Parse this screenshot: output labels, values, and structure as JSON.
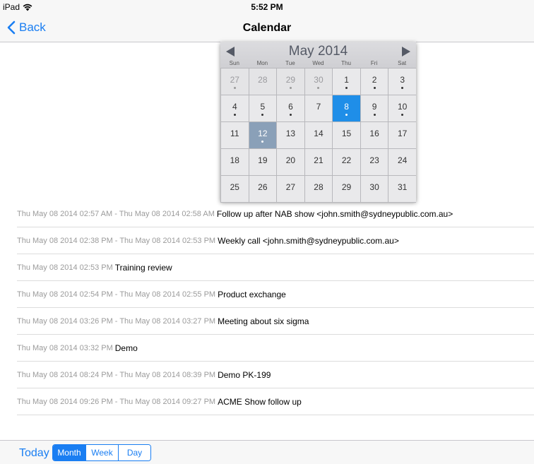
{
  "status_bar": {
    "device": "iPad",
    "time": "5:52 PM"
  },
  "nav": {
    "back_label": "Back",
    "title": "Calendar"
  },
  "calendar": {
    "month_title": "May 2014",
    "weekdays": [
      "Sun",
      "Mon",
      "Tue",
      "Wed",
      "Thu",
      "Fri",
      "Sat"
    ],
    "weeks": [
      [
        {
          "day": "27",
          "other": true,
          "dot": true
        },
        {
          "day": "28",
          "other": true,
          "dot": false
        },
        {
          "day": "29",
          "other": true,
          "dot": true
        },
        {
          "day": "30",
          "other": true,
          "dot": true
        },
        {
          "day": "1",
          "other": false,
          "dot": true
        },
        {
          "day": "2",
          "other": false,
          "dot": true
        },
        {
          "day": "3",
          "other": false,
          "dot": true
        }
      ],
      [
        {
          "day": "4",
          "other": false,
          "dot": true
        },
        {
          "day": "5",
          "other": false,
          "dot": true
        },
        {
          "day": "6",
          "other": false,
          "dot": true
        },
        {
          "day": "7",
          "other": false,
          "dot": false
        },
        {
          "day": "8",
          "other": false,
          "dot": true,
          "selected": true
        },
        {
          "day": "9",
          "other": false,
          "dot": true
        },
        {
          "day": "10",
          "other": false,
          "dot": true
        }
      ],
      [
        {
          "day": "11",
          "other": false,
          "dot": false
        },
        {
          "day": "12",
          "other": false,
          "dot": true,
          "today": true
        },
        {
          "day": "13",
          "other": false,
          "dot": false
        },
        {
          "day": "14",
          "other": false,
          "dot": false
        },
        {
          "day": "15",
          "other": false,
          "dot": false
        },
        {
          "day": "16",
          "other": false,
          "dot": false
        },
        {
          "day": "17",
          "other": false,
          "dot": false
        }
      ],
      [
        {
          "day": "18",
          "other": false,
          "dot": false
        },
        {
          "day": "19",
          "other": false,
          "dot": false
        },
        {
          "day": "20",
          "other": false,
          "dot": false
        },
        {
          "day": "21",
          "other": false,
          "dot": false
        },
        {
          "day": "22",
          "other": false,
          "dot": false
        },
        {
          "day": "23",
          "other": false,
          "dot": false
        },
        {
          "day": "24",
          "other": false,
          "dot": false
        }
      ],
      [
        {
          "day": "25",
          "other": false,
          "dot": false
        },
        {
          "day": "26",
          "other": false,
          "dot": false
        },
        {
          "day": "27",
          "other": false,
          "dot": false
        },
        {
          "day": "28",
          "other": false,
          "dot": false
        },
        {
          "day": "29",
          "other": false,
          "dot": false
        },
        {
          "day": "30",
          "other": false,
          "dot": false
        },
        {
          "day": "31",
          "other": false,
          "dot": false
        }
      ]
    ]
  },
  "events": [
    {
      "time": "Thu May 08 2014 02:57 AM - Thu May 08 2014 02:58 AM",
      "title": "Follow up after NAB show <john.smith@sydneypublic.com.au>"
    },
    {
      "time": "Thu May 08 2014 02:38 PM - Thu May 08 2014 02:53 PM",
      "title": "Weekly call <john.smith@sydneypublic.com.au>"
    },
    {
      "time": "Thu May 08 2014 02:53 PM",
      "title": "Training review"
    },
    {
      "time": "Thu May 08 2014 02:54 PM - Thu May 08 2014 02:55 PM",
      "title": "Product exchange"
    },
    {
      "time": "Thu May 08 2014 03:26 PM - Thu May 08 2014 03:27 PM",
      "title": "Meeting about six sigma"
    },
    {
      "time": "Thu May 08 2014 03:32 PM",
      "title": "Demo"
    },
    {
      "time": "Thu May 08 2014 08:24 PM - Thu May 08 2014 08:39 PM",
      "title": "Demo PK-199"
    },
    {
      "time": "Thu May 08 2014 09:26 PM - Thu May 08 2014 09:27 PM",
      "title": "ACME Show follow up"
    }
  ],
  "toolbar": {
    "today_label": "Today",
    "segments": [
      {
        "label": "Month",
        "active": true
      },
      {
        "label": "Week",
        "active": false
      },
      {
        "label": "Day",
        "active": false
      }
    ]
  },
  "colors": {
    "accent": "#1a7ef2",
    "selected_day": "#1f8ee8",
    "today_day": "#8aa0b8"
  }
}
